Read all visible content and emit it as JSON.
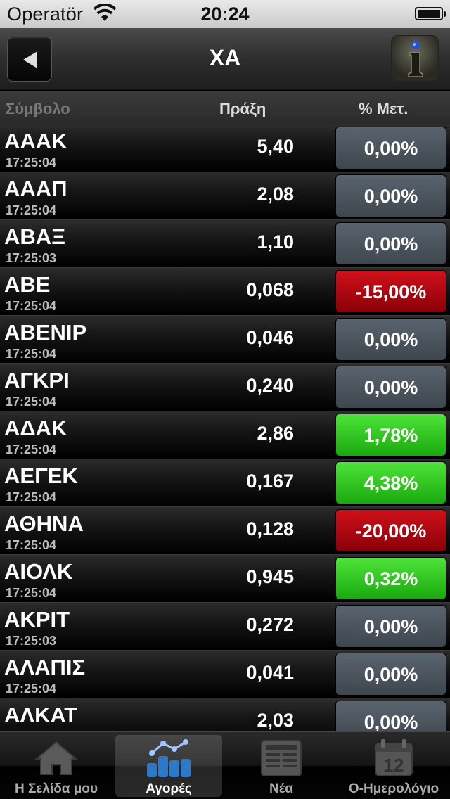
{
  "status_bar": {
    "carrier": "Operatör",
    "time": "20:24"
  },
  "nav": {
    "title": "ΧΑ",
    "back_icon": "back-arrow-icon",
    "info_icon": "info-icon"
  },
  "columns": {
    "symbol": "Σύμβολο",
    "price": "Πράξη",
    "change": "% Μετ."
  },
  "colors": {
    "up": "#2fc41f",
    "down": "#b00812",
    "neutral": "#4c555e"
  },
  "rows": [
    {
      "symbol": "ΑΑΑΚ",
      "time": "17:25:04",
      "price": "5,40",
      "change": "0,00%",
      "trend": "neutral"
    },
    {
      "symbol": "ΑΑΑΠ",
      "time": "17:25:04",
      "price": "2,08",
      "change": "0,00%",
      "trend": "neutral"
    },
    {
      "symbol": "ΑΒΑΞ",
      "time": "17:25:03",
      "price": "1,10",
      "change": "0,00%",
      "trend": "neutral"
    },
    {
      "symbol": "ΑΒΕ",
      "time": "17:25:04",
      "price": "0,068",
      "change": "-15,00%",
      "trend": "down"
    },
    {
      "symbol": "ΑΒΕΝΙΡ",
      "time": "17:25:04",
      "price": "0,046",
      "change": "0,00%",
      "trend": "neutral"
    },
    {
      "symbol": "ΑΓΚΡΙ",
      "time": "17:25:04",
      "price": "0,240",
      "change": "0,00%",
      "trend": "neutral"
    },
    {
      "symbol": "ΑΔΑΚ",
      "time": "17:25:04",
      "price": "2,86",
      "change": "1,78%",
      "trend": "up"
    },
    {
      "symbol": "ΑΕΓΕΚ",
      "time": "17:25:04",
      "price": "0,167",
      "change": "4,38%",
      "trend": "up"
    },
    {
      "symbol": "ΑΘΗΝΑ",
      "time": "17:25:04",
      "price": "0,128",
      "change": "-20,00%",
      "trend": "down"
    },
    {
      "symbol": "ΑΙΟΛΚ",
      "time": "17:25:04",
      "price": "0,945",
      "change": "0,32%",
      "trend": "up"
    },
    {
      "symbol": "ΑΚΡΙΤ",
      "time": "17:25:03",
      "price": "0,272",
      "change": "0,00%",
      "trend": "neutral"
    },
    {
      "symbol": "ΑΛΑΠΙΣ",
      "time": "17:25:04",
      "price": "0,041",
      "change": "0,00%",
      "trend": "neutral"
    },
    {
      "symbol": "ΑΛΚΑΤ",
      "time": "",
      "price": "2,03",
      "change": "0,00%",
      "trend": "neutral"
    }
  ],
  "tabs": [
    {
      "label": "Η Σελίδα μου",
      "icon": "home-icon",
      "active": false
    },
    {
      "label": "Αγορές",
      "icon": "markets-chart-icon",
      "active": true
    },
    {
      "label": "Νέα",
      "icon": "newspaper-icon",
      "active": false
    },
    {
      "label": "Ο-Ημερολόγιο",
      "icon": "calendar-icon",
      "active": false
    }
  ],
  "calendar_icon_day": "12"
}
